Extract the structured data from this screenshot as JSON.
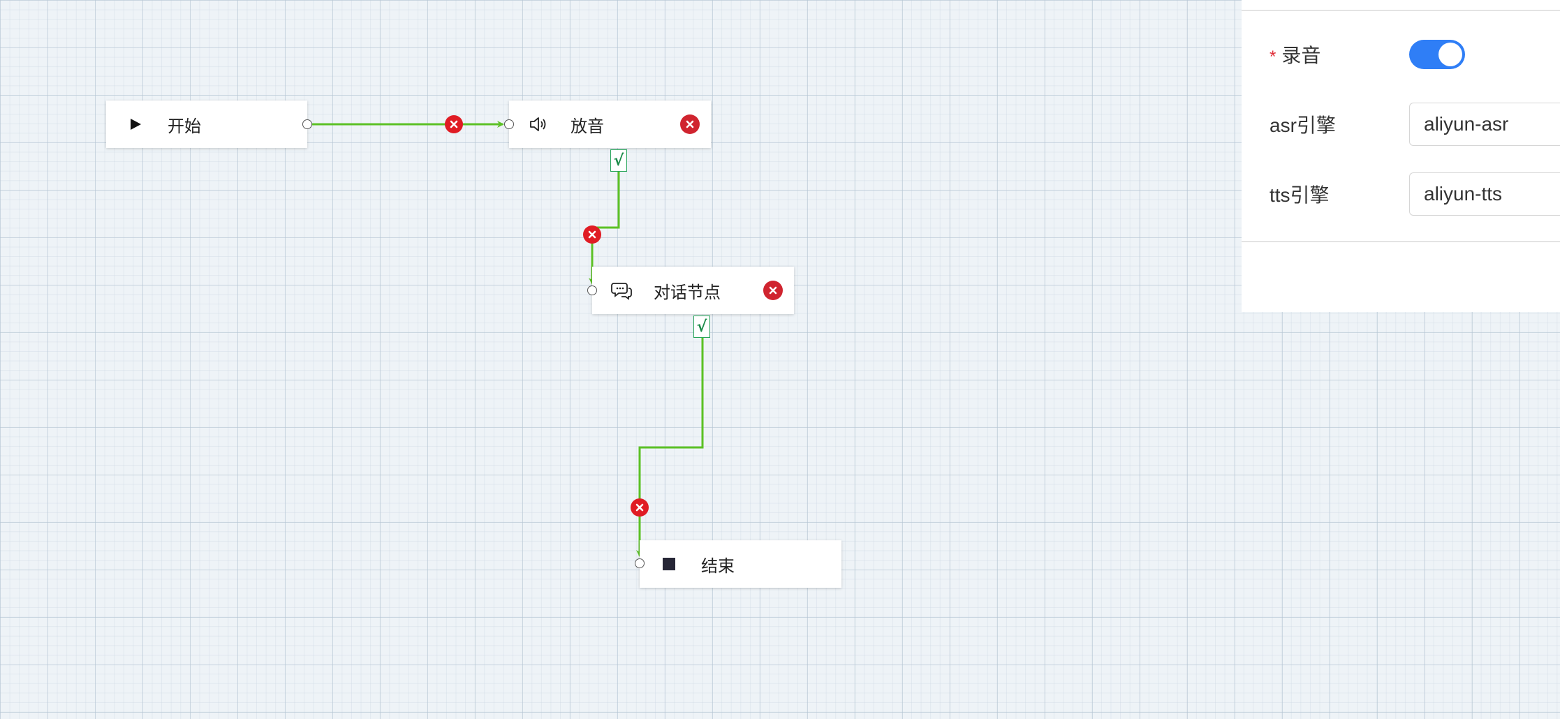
{
  "flow": {
    "nodes": {
      "start": {
        "label": "开始",
        "icon": "play-icon"
      },
      "play_audio": {
        "label": "放音",
        "icon": "speaker-icon"
      },
      "dialog": {
        "label": "对话节点",
        "icon": "chat-bubbles-icon"
      },
      "end": {
        "label": "结束",
        "icon": "stop-square-icon"
      }
    },
    "check_mark": "√",
    "colors": {
      "edge": "#5cc126",
      "delete": "#e01c24",
      "node_delete": "#d0242f",
      "check": "#27a55a"
    }
  },
  "panel": {
    "record": {
      "required_mark": "*",
      "label": "录音",
      "enabled": true
    },
    "asr": {
      "label": "asr引擎",
      "value": "aliyun-asr"
    },
    "tts": {
      "label": "tts引擎",
      "value": "aliyun-tts"
    },
    "colors": {
      "toggle_on": "#2f7ef6",
      "required": "#e0303a"
    }
  }
}
